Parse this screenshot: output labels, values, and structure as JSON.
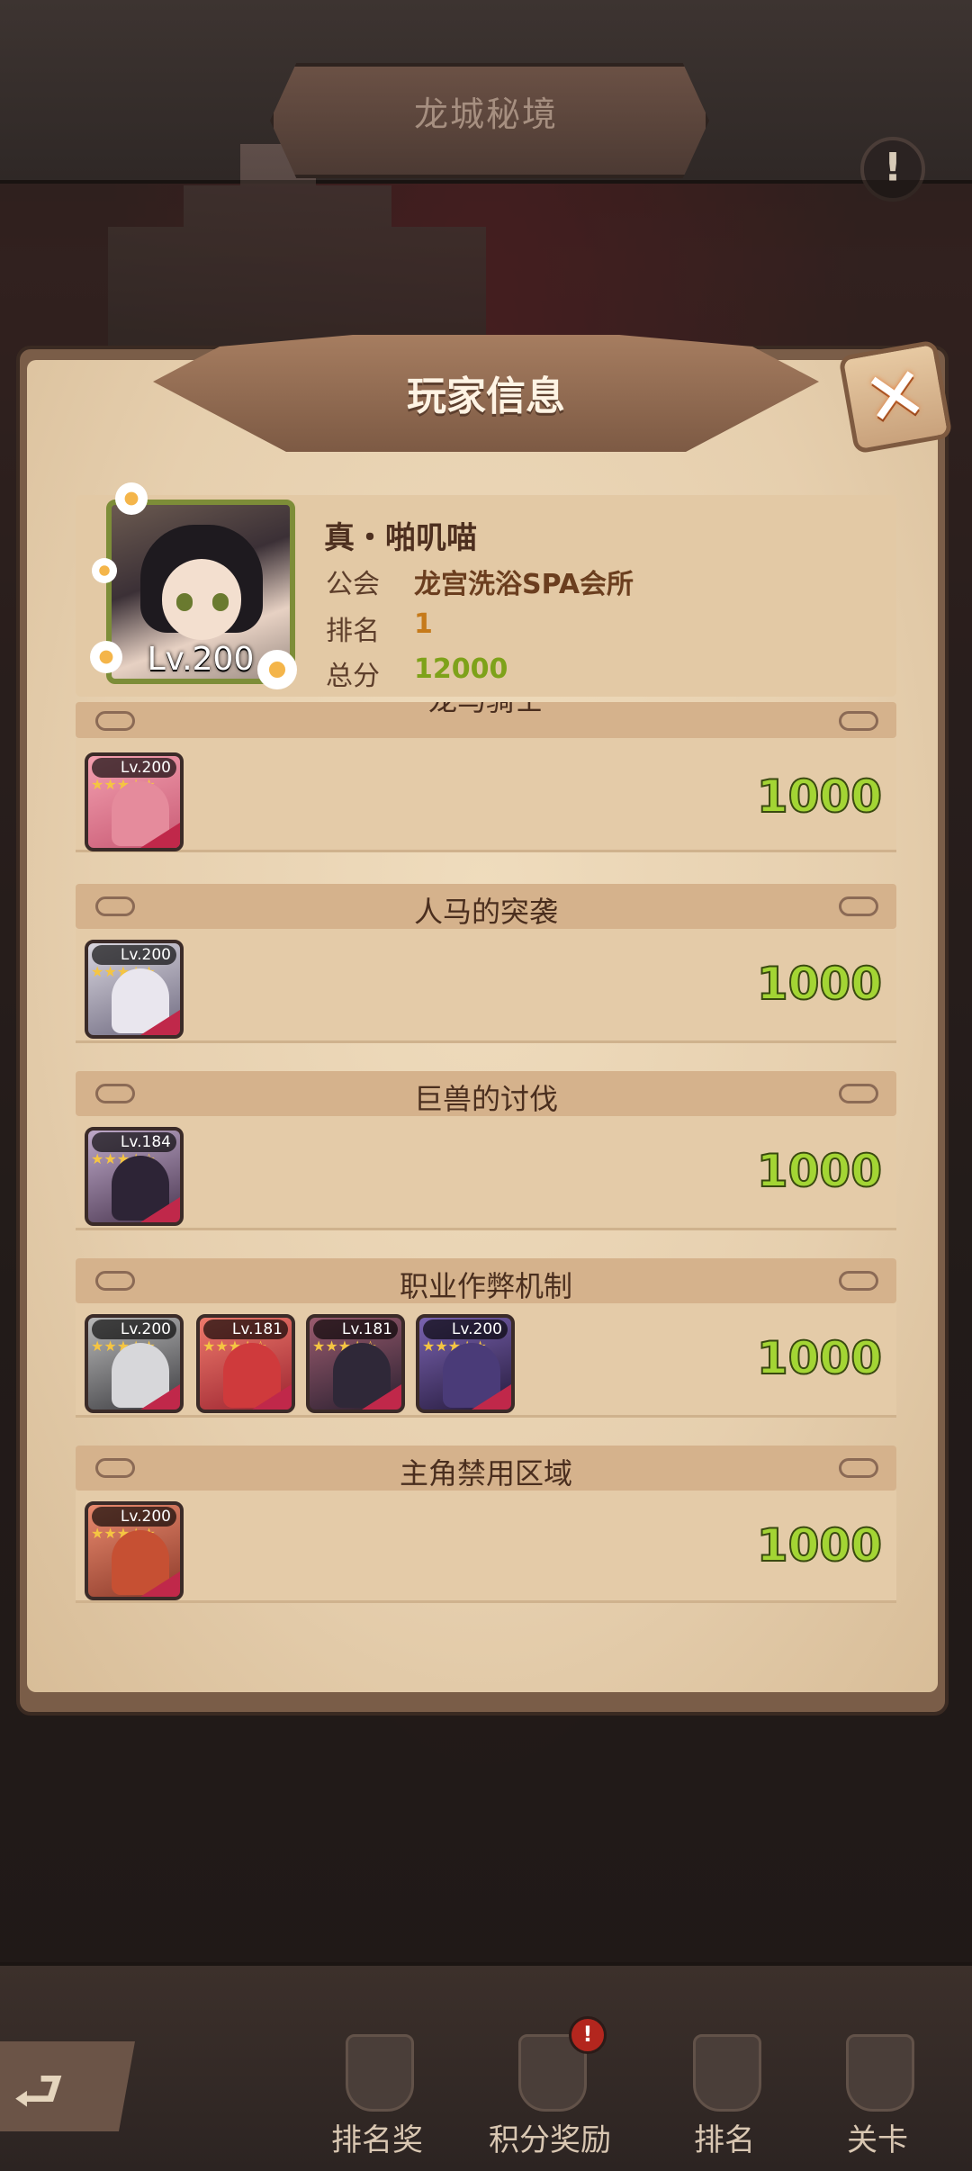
{
  "game": {
    "title": "龙城秘境"
  },
  "dialog": {
    "title": "玩家信息"
  },
  "player": {
    "name": "真・啪叽喵",
    "level": "Lv.200",
    "guild_label": "公会",
    "guild": "龙宫洗浴SPA会所",
    "rank_label": "排名",
    "rank": "1",
    "score_label": "总分",
    "score": "12000"
  },
  "sections": [
    {
      "title": "龙马骑士",
      "score": "1000",
      "heroes": [
        {
          "lv": "Lv.200"
        }
      ]
    },
    {
      "title": "人马的突袭",
      "score": "1000",
      "heroes": [
        {
          "lv": "Lv.200"
        }
      ]
    },
    {
      "title": "巨兽的讨伐",
      "score": "1000",
      "heroes": [
        {
          "lv": "Lv.184"
        }
      ]
    },
    {
      "title": "职业作弊机制",
      "score": "1000",
      "heroes": [
        {
          "lv": "Lv.200"
        },
        {
          "lv": "Lv.181"
        },
        {
          "lv": "Lv.181"
        },
        {
          "lv": "Lv.200"
        }
      ]
    },
    {
      "title": "主角禁用区域",
      "score": "1000",
      "heroes": [
        {
          "lv": "Lv.200"
        }
      ]
    }
  ],
  "nav": [
    {
      "label": "排名奖",
      "icon": "rank-reward-icon"
    },
    {
      "label": "积分奖励",
      "icon": "points-reward-icon",
      "badge": "!"
    },
    {
      "label": "排名",
      "icon": "ranking-icon"
    },
    {
      "label": "关卡",
      "icon": "stage-icon"
    }
  ],
  "icons": {
    "info": "!",
    "close": "✕",
    "back": "⮐"
  },
  "colors": {
    "score_green": "#a3d534",
    "rank_orange": "#c67a1a",
    "badge_red": "#b3261e"
  }
}
